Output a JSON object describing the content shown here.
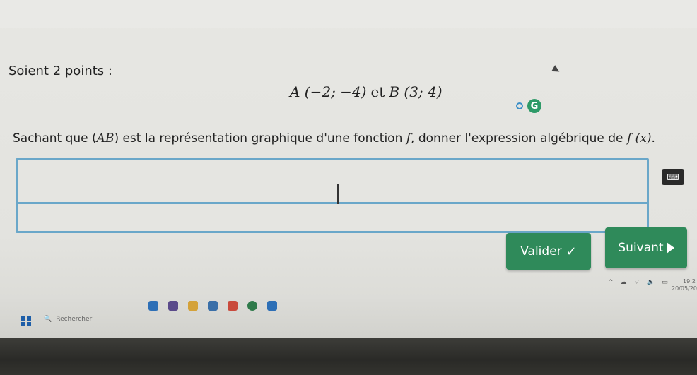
{
  "question": {
    "title": "Soient 2 points :",
    "point_a": "A (−2; −4)",
    "conj": "et",
    "point_b": "B (3; 4)",
    "badge_letter": "G",
    "instruction_pre": "Sachant que (",
    "instruction_ab": "AB",
    "instruction_mid": ") est la représentation graphique d'une fonction ",
    "instruction_f": "f",
    "instruction_post": ", donner l'expression algébrique de ",
    "instruction_fx": "f (x)",
    "instruction_end": "."
  },
  "answer": {
    "value": ""
  },
  "buttons": {
    "valider": "Valider",
    "valider_icon": "check-icon",
    "suivant": "Suivant",
    "suivant_icon": "play-icon"
  },
  "taskbar": {
    "search_placeholder": "Rechercher",
    "time": "19:2",
    "date": "20/05/202"
  },
  "colors": {
    "accent_green": "#2f8a5a",
    "input_border": "#6aa7c9",
    "badge_green": "#2e9a68"
  }
}
